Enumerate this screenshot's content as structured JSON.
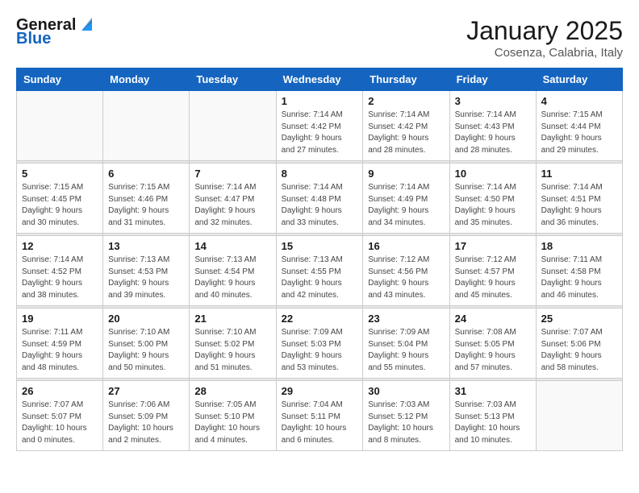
{
  "header": {
    "logo_general": "General",
    "logo_blue": "Blue",
    "month_title": "January 2025",
    "subtitle": "Cosenza, Calabria, Italy"
  },
  "weekdays": [
    "Sunday",
    "Monday",
    "Tuesday",
    "Wednesday",
    "Thursday",
    "Friday",
    "Saturday"
  ],
  "weeks": [
    [
      {
        "day": "",
        "info": ""
      },
      {
        "day": "",
        "info": ""
      },
      {
        "day": "",
        "info": ""
      },
      {
        "day": "1",
        "info": "Sunrise: 7:14 AM\nSunset: 4:42 PM\nDaylight: 9 hours\nand 27 minutes."
      },
      {
        "day": "2",
        "info": "Sunrise: 7:14 AM\nSunset: 4:42 PM\nDaylight: 9 hours\nand 28 minutes."
      },
      {
        "day": "3",
        "info": "Sunrise: 7:14 AM\nSunset: 4:43 PM\nDaylight: 9 hours\nand 28 minutes."
      },
      {
        "day": "4",
        "info": "Sunrise: 7:15 AM\nSunset: 4:44 PM\nDaylight: 9 hours\nand 29 minutes."
      }
    ],
    [
      {
        "day": "5",
        "info": "Sunrise: 7:15 AM\nSunset: 4:45 PM\nDaylight: 9 hours\nand 30 minutes."
      },
      {
        "day": "6",
        "info": "Sunrise: 7:15 AM\nSunset: 4:46 PM\nDaylight: 9 hours\nand 31 minutes."
      },
      {
        "day": "7",
        "info": "Sunrise: 7:14 AM\nSunset: 4:47 PM\nDaylight: 9 hours\nand 32 minutes."
      },
      {
        "day": "8",
        "info": "Sunrise: 7:14 AM\nSunset: 4:48 PM\nDaylight: 9 hours\nand 33 minutes."
      },
      {
        "day": "9",
        "info": "Sunrise: 7:14 AM\nSunset: 4:49 PM\nDaylight: 9 hours\nand 34 minutes."
      },
      {
        "day": "10",
        "info": "Sunrise: 7:14 AM\nSunset: 4:50 PM\nDaylight: 9 hours\nand 35 minutes."
      },
      {
        "day": "11",
        "info": "Sunrise: 7:14 AM\nSunset: 4:51 PM\nDaylight: 9 hours\nand 36 minutes."
      }
    ],
    [
      {
        "day": "12",
        "info": "Sunrise: 7:14 AM\nSunset: 4:52 PM\nDaylight: 9 hours\nand 38 minutes."
      },
      {
        "day": "13",
        "info": "Sunrise: 7:13 AM\nSunset: 4:53 PM\nDaylight: 9 hours\nand 39 minutes."
      },
      {
        "day": "14",
        "info": "Sunrise: 7:13 AM\nSunset: 4:54 PM\nDaylight: 9 hours\nand 40 minutes."
      },
      {
        "day": "15",
        "info": "Sunrise: 7:13 AM\nSunset: 4:55 PM\nDaylight: 9 hours\nand 42 minutes."
      },
      {
        "day": "16",
        "info": "Sunrise: 7:12 AM\nSunset: 4:56 PM\nDaylight: 9 hours\nand 43 minutes."
      },
      {
        "day": "17",
        "info": "Sunrise: 7:12 AM\nSunset: 4:57 PM\nDaylight: 9 hours\nand 45 minutes."
      },
      {
        "day": "18",
        "info": "Sunrise: 7:11 AM\nSunset: 4:58 PM\nDaylight: 9 hours\nand 46 minutes."
      }
    ],
    [
      {
        "day": "19",
        "info": "Sunrise: 7:11 AM\nSunset: 4:59 PM\nDaylight: 9 hours\nand 48 minutes."
      },
      {
        "day": "20",
        "info": "Sunrise: 7:10 AM\nSunset: 5:00 PM\nDaylight: 9 hours\nand 50 minutes."
      },
      {
        "day": "21",
        "info": "Sunrise: 7:10 AM\nSunset: 5:02 PM\nDaylight: 9 hours\nand 51 minutes."
      },
      {
        "day": "22",
        "info": "Sunrise: 7:09 AM\nSunset: 5:03 PM\nDaylight: 9 hours\nand 53 minutes."
      },
      {
        "day": "23",
        "info": "Sunrise: 7:09 AM\nSunset: 5:04 PM\nDaylight: 9 hours\nand 55 minutes."
      },
      {
        "day": "24",
        "info": "Sunrise: 7:08 AM\nSunset: 5:05 PM\nDaylight: 9 hours\nand 57 minutes."
      },
      {
        "day": "25",
        "info": "Sunrise: 7:07 AM\nSunset: 5:06 PM\nDaylight: 9 hours\nand 58 minutes."
      }
    ],
    [
      {
        "day": "26",
        "info": "Sunrise: 7:07 AM\nSunset: 5:07 PM\nDaylight: 10 hours\nand 0 minutes."
      },
      {
        "day": "27",
        "info": "Sunrise: 7:06 AM\nSunset: 5:09 PM\nDaylight: 10 hours\nand 2 minutes."
      },
      {
        "day": "28",
        "info": "Sunrise: 7:05 AM\nSunset: 5:10 PM\nDaylight: 10 hours\nand 4 minutes."
      },
      {
        "day": "29",
        "info": "Sunrise: 7:04 AM\nSunset: 5:11 PM\nDaylight: 10 hours\nand 6 minutes."
      },
      {
        "day": "30",
        "info": "Sunrise: 7:03 AM\nSunset: 5:12 PM\nDaylight: 10 hours\nand 8 minutes."
      },
      {
        "day": "31",
        "info": "Sunrise: 7:03 AM\nSunset: 5:13 PM\nDaylight: 10 hours\nand 10 minutes."
      },
      {
        "day": "",
        "info": ""
      }
    ]
  ]
}
